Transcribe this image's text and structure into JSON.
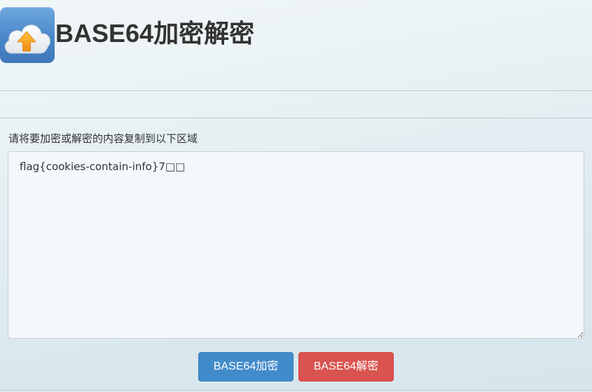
{
  "header": {
    "title": "BASE64加密解密",
    "logo_icon": "cloud-upload-icon"
  },
  "form": {
    "prompt_label": "请将要加密或解密的内容复制到以下区域",
    "textarea_value": "flag{cookies-contain-info}7□□"
  },
  "buttons": {
    "encode_label": "BASE64加密",
    "decode_label": "BASE64解密"
  },
  "colors": {
    "encode_button": "#428bca",
    "decode_button": "#d9534f",
    "logo": "#4a87c9",
    "arrow": "#f7a21b"
  }
}
